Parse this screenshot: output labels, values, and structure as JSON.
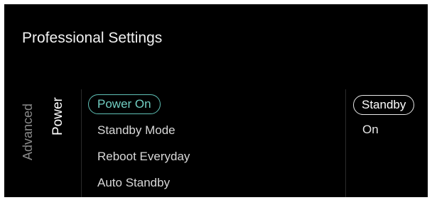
{
  "header": {
    "title": "Professional Settings"
  },
  "side_tabs": [
    {
      "label": "Advanced",
      "active": false
    },
    {
      "label": "Power",
      "active": true
    }
  ],
  "menu": {
    "items": [
      {
        "label": "Power On",
        "selected": true
      },
      {
        "label": "Standby Mode",
        "selected": false
      },
      {
        "label": "Reboot Everyday",
        "selected": false
      },
      {
        "label": "Auto Standby",
        "selected": false
      }
    ]
  },
  "options": {
    "items": [
      {
        "label": "Standby",
        "selected": true
      },
      {
        "label": "On",
        "selected": false
      }
    ]
  },
  "colors": {
    "background": "#000000",
    "accent": "#5fc1b6",
    "inactive_text": "#8a8a8a"
  }
}
